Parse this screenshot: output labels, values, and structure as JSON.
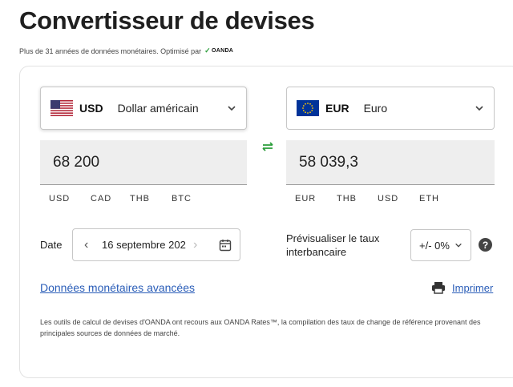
{
  "header": {
    "title": "Convertisseur de devises",
    "subtitle": "Plus de 31 années de données monétaires. Optimisé par",
    "logo_text": "OANDA"
  },
  "from": {
    "code": "USD",
    "name": "Dollar américain",
    "flag": "us-flag-icon",
    "amount": "68 200",
    "quick": [
      "USD",
      "CAD",
      "THB",
      "BTC"
    ]
  },
  "to": {
    "code": "EUR",
    "name": "Euro",
    "flag": "eu-flag-icon",
    "amount": "58 039,3",
    "quick": [
      "EUR",
      "THB",
      "USD",
      "ETH"
    ]
  },
  "date": {
    "label": "Date",
    "value": "16 septembre 202"
  },
  "interbank": {
    "label": "Prévisualiser le taux interbancaire",
    "value": "+/- 0%"
  },
  "links": {
    "advanced": "Données monétaires avancées",
    "print": "Imprimer"
  },
  "disclaimer": "Les outils de calcul de devises d'OANDA ont recours aux OANDA Rates™, la compilation des taux de change de référence provenant des principales sources de données de marché.",
  "colors": {
    "link": "#2a5db8",
    "swap": "#2a9d3a",
    "field_bg": "#eeeeee"
  }
}
